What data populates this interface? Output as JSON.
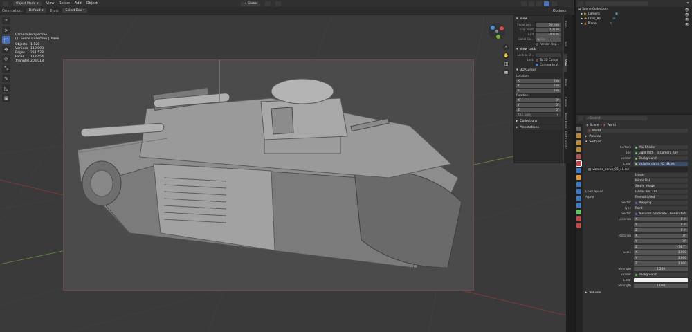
{
  "header": {
    "mode": "Object Mode",
    "menus": [
      "View",
      "Select",
      "Add",
      "Object"
    ],
    "orientation_label": "Orientation:",
    "orientation": "Default",
    "drag_label": "Drag:",
    "drag": "Select Box",
    "transform_pivot": "Global",
    "options": "Options"
  },
  "viewport": {
    "title": "Camera Perspective",
    "collection": "(1) Scene Collection | Plane",
    "stats": [
      {
        "k": "Objects",
        "v": "1,128"
      },
      {
        "k": "Vertices",
        "v": "110,093"
      },
      {
        "k": "Edges",
        "v": "221,528"
      },
      {
        "k": "Faces",
        "v": "113,454"
      },
      {
        "k": "Triangles",
        "v": "208,018"
      }
    ]
  },
  "npanel": {
    "view_header": "View",
    "focal_label": "Focal Len...",
    "focal": "50 mm",
    "clip_start_label": "Clip Start",
    "clip_start": "0.01 m",
    "clip_end_label": "End",
    "clip_end": "1000 m",
    "local_label": "Local Ca...",
    "render_region": "Render Reg...",
    "view_lock_header": "View Lock",
    "lock_to_label": "Lock to O...",
    "lock_label": "Lock",
    "to_3d_cursor": "To 3D Cursor",
    "camera_to_view": "Camera to V...",
    "cursor_header": "3D Cursor",
    "location_label": "Location:",
    "loc": [
      {
        "k": "X",
        "v": "0 m"
      },
      {
        "k": "Y",
        "v": "0 m"
      },
      {
        "k": "Z",
        "v": "0 m"
      }
    ],
    "rotation_label": "Rotation:",
    "rot": [
      {
        "k": "X",
        "v": "0°"
      },
      {
        "k": "Y",
        "v": "0°"
      },
      {
        "k": "Z",
        "v": "0°"
      }
    ],
    "euler": "XYZ Euler",
    "collections": "Collections",
    "annotations": "Annotations",
    "tabs": [
      "Item",
      "Tool",
      "View",
      "Blenr",
      "Create",
      "Blen Bloks",
      "Earth Studio"
    ]
  },
  "outliner": {
    "root": "Scene Collection",
    "items": [
      "Camera",
      "Char_B1",
      "Plane"
    ]
  },
  "props": {
    "search_placeholder": "Search",
    "breadcrumb_scene": "Scene",
    "breadcrumb_world": "World",
    "world_name": "World",
    "preview": "Preview",
    "surface_header": "Surface",
    "rows": [
      {
        "l": "Surface",
        "v": "Mix Shader",
        "dot": "g"
      },
      {
        "l": "Fac",
        "v": "Light Path | Is Camera Ray",
        "dot": "g"
      },
      {
        "l": "Shader",
        "v": "Background",
        "dot": "g"
      },
      {
        "l": "Color",
        "v": "victoria_carvo_02_4k.exr",
        "dot": "y"
      }
    ],
    "image_name": "victoria_carvo_02_4k.exr",
    "interp": "Linear",
    "projection": "Mirror Ball",
    "single": "Single Image",
    "color_space_label": "Color Space",
    "color_space": "Linear Rec.709",
    "alpha_label": "Alpha",
    "alpha": "Premultiplied",
    "vector_label": "Vector",
    "vector": "Mapping",
    "type_label": "Type",
    "type": "Point",
    "vector2": "Texture Coordinate | Generated",
    "location_label": "Location",
    "location": [
      {
        "k": "X",
        "v": "0 m"
      },
      {
        "k": "Y",
        "v": "0 m"
      },
      {
        "k": "Z",
        "v": "0 m"
      }
    ],
    "rotation_label": "Rotation",
    "rotation": [
      {
        "k": "X",
        "v": "0°"
      },
      {
        "k": "Y",
        "v": "0°"
      },
      {
        "k": "Z",
        "v": "-74.7°"
      }
    ],
    "scale_label": "Scale",
    "scale": [
      {
        "k": "X",
        "v": "1.000"
      },
      {
        "k": "Y",
        "v": "1.000"
      },
      {
        "k": "Z",
        "v": "1.000"
      }
    ],
    "strength_label": "Strength",
    "strength": "1.200",
    "shader2_label": "Shader",
    "shader2": "Background",
    "color2_label": "Color",
    "strength2_label": "Strength",
    "strength2": "1.000",
    "volume": "Volume"
  },
  "colors": {
    "accent": "#4772b3",
    "socket_green": "#63c763",
    "socket_yellow": "#c7c729"
  }
}
